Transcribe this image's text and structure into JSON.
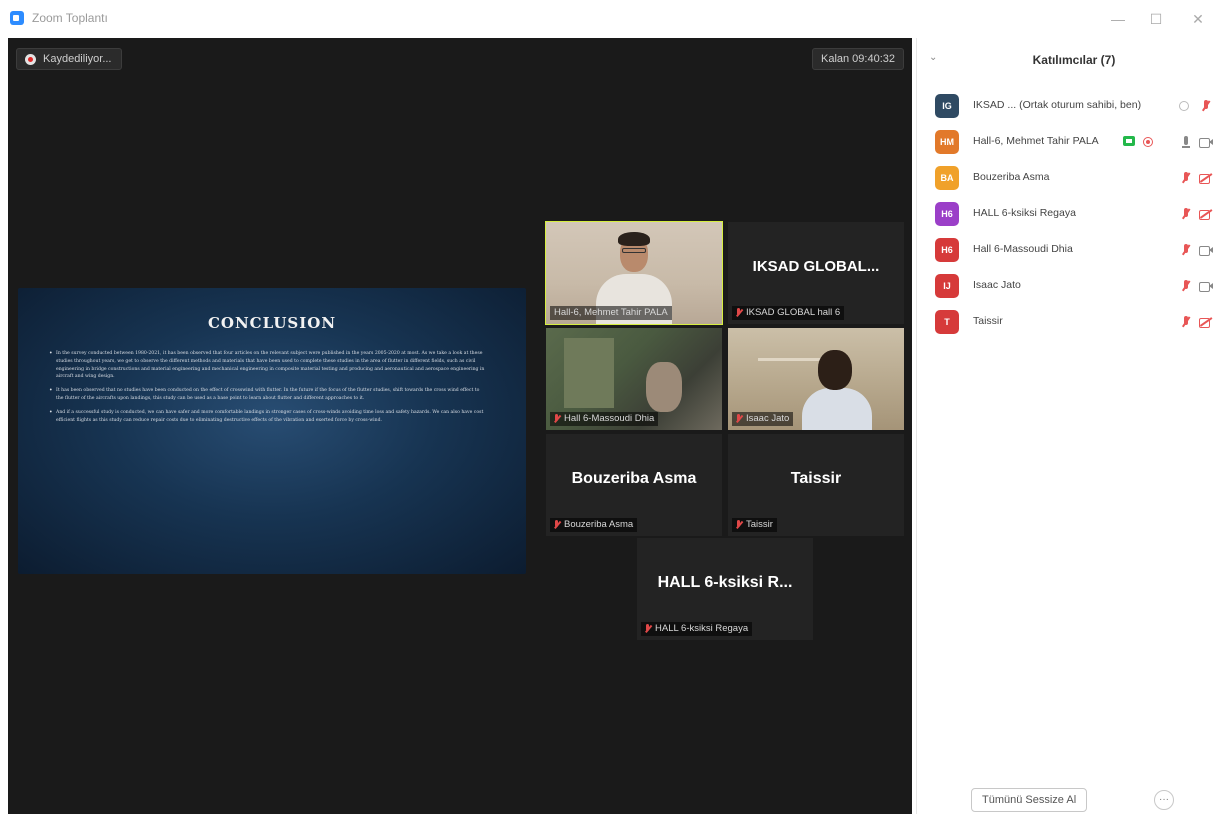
{
  "window": {
    "title": "Zoom Toplantı"
  },
  "meeting": {
    "recording_label": "Kaydediliyor...",
    "timer_label": "Kalan 09:40:32"
  },
  "slide": {
    "title": "CONCLUSION",
    "bullets": [
      "In the survey conducted between 1980-2021, it has been observed that four articles on the relevant subject were published in the years 2005-2020 at most. As we take a look at these studies throughout years, we get to observe the different methods and materials that have been used to complete these studies in the area of flutter in different fields, such as civil engineering in bridge constructions and material engineering and mechanical engineering in composite material testing and producing and aeronautical and aerospace engineering in aircraft and wing design.",
      "It has been observed that no studies have been conducted on the effect of crosswind with flutter. In the future if the focus of the flutter studies, shift towards the cross wind effect to the flutter of the aircrafts upon landings, this study can be used as a base point to learn about flutter and different approaches to it.",
      "And if a successful study is conducted, we can have safer and more comfortable landings in stronger cases of cross-winds avoiding time loss and safety hazards. We can also have cost efficient flights as this study can reduce repair costs due to eliminating destructive effects of the vibration and exerted force by cross-wind."
    ]
  },
  "tiles": [
    {
      "label": "Hall-6, Mehmet Tahir PALA",
      "big_name": ""
    },
    {
      "label": "IKSAD GLOBAL hall 6",
      "big_name": "IKSAD GLOBAL..."
    },
    {
      "label": "Hall 6-Massoudi Dhia",
      "big_name": ""
    },
    {
      "label": "Isaac Jato",
      "big_name": ""
    },
    {
      "label": "Bouzeriba Asma",
      "big_name": "Bouzeriba Asma"
    },
    {
      "label": "Taissir",
      "big_name": "Taissir"
    },
    {
      "label": "HALL 6-ksiksi Regaya",
      "big_name": "HALL 6-ksiksi R..."
    }
  ],
  "panel": {
    "title": "Katılımcılar (7)",
    "mute_all_label": "Tümünü Sessize Al",
    "more_label": "···",
    "participants": [
      {
        "initials": "IG",
        "color": "#2f4a63",
        "name": "IKSAD ...  (Ortak oturum sahibi, ben)"
      },
      {
        "initials": "HM",
        "color": "#e2792a",
        "name": "Hall-6, Mehmet Tahir PALA"
      },
      {
        "initials": "BA",
        "color": "#f0a12a",
        "name": "Bouzeriba Asma"
      },
      {
        "initials": "H6",
        "color": "#9b3fc8",
        "name": "HALL 6-ksiksi Regaya"
      },
      {
        "initials": "H6",
        "color": "#d63a3a",
        "name": "Hall 6-Massoudi Dhia"
      },
      {
        "initials": "IJ",
        "color": "#d63a3a",
        "name": "Isaac Jato"
      },
      {
        "initials": "T",
        "color": "#d63a3a",
        "name": "Taissir"
      }
    ]
  },
  "colors": {
    "accent": "#2D8CFF",
    "active_speaker": "#d6ee40",
    "muted": "#e85656",
    "sharing": "#23b84a"
  }
}
